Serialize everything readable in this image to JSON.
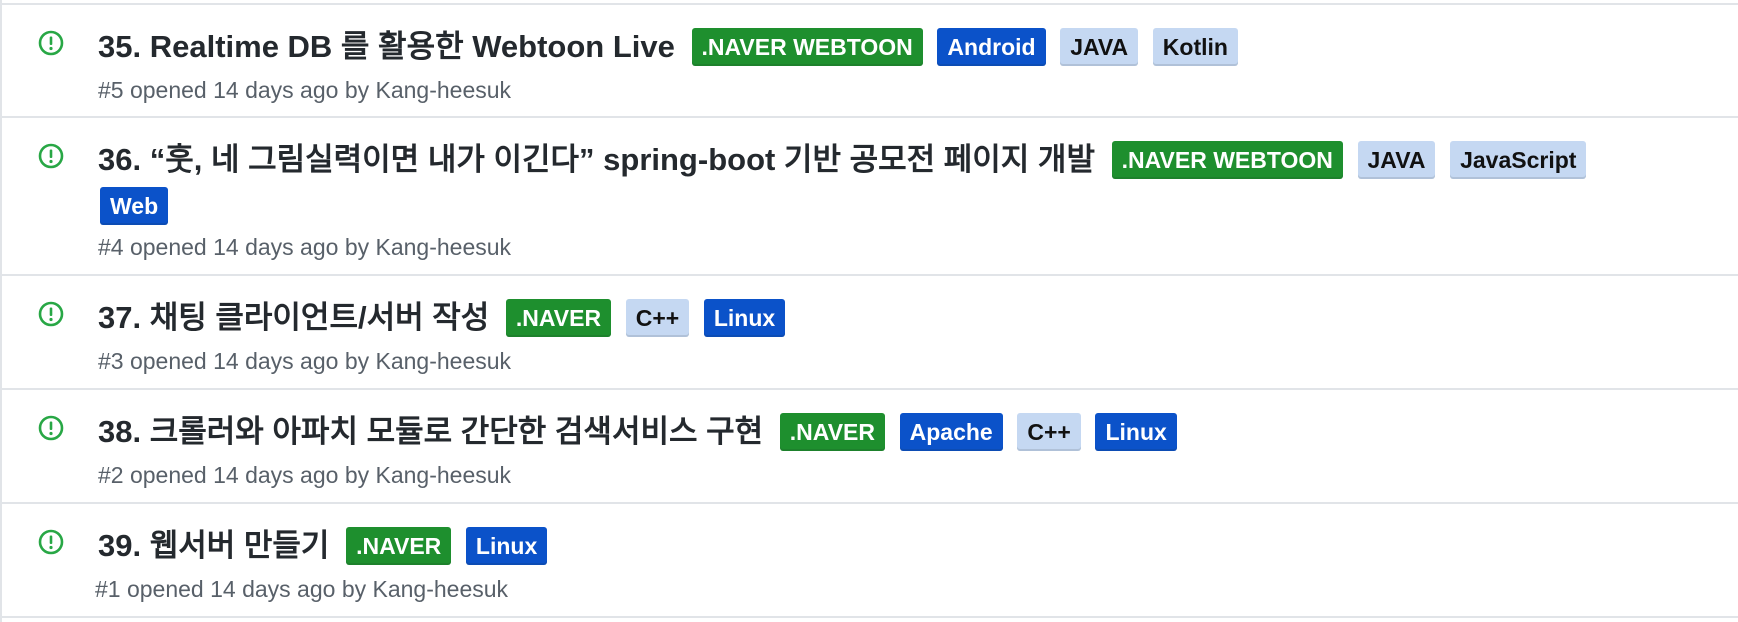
{
  "colors": {
    "open_icon": "#28a745",
    "border": "#e1e4e8",
    "meta_text": "#586069"
  },
  "label_styles": {
    ".NAVER WEBTOON": {
      "bg": "#1e8f2e",
      "fg": "#ffffff"
    },
    ".NAVER": {
      "bg": "#1e8f2e",
      "fg": "#ffffff"
    },
    "Android": {
      "bg": "#0b52c9",
      "fg": "#ffffff"
    },
    "Web": {
      "bg": "#0b52c9",
      "fg": "#ffffff"
    },
    "Linux": {
      "bg": "#0b52c9",
      "fg": "#ffffff"
    },
    "Apache": {
      "bg": "#0b52c9",
      "fg": "#ffffff"
    },
    "JAVA": {
      "bg": "#c5d8f2",
      "fg": "#111111"
    },
    "Kotlin": {
      "bg": "#c5d8f2",
      "fg": "#111111"
    },
    "JavaScript": {
      "bg": "#c5d8f2",
      "fg": "#111111"
    },
    "C++": {
      "bg": "#c5d8f2",
      "fg": "#111111"
    }
  },
  "issues": [
    {
      "icon": "issue-opened-icon",
      "title": "35. Realtime DB 를 활용한 Webtoon Live",
      "labels": [
        ".NAVER WEBTOON",
        "Android",
        "JAVA",
        "Kotlin"
      ],
      "meta": "#5 opened 14 days ago by Kang-heesuk"
    },
    {
      "icon": "issue-opened-icon",
      "title": "36. “훗, 네 그림실력이면 내가 이긴다” spring-boot 기반 공모전 페이지 개발",
      "labels": [
        ".NAVER WEBTOON",
        "JAVA",
        "JavaScript",
        "Web"
      ],
      "meta": "#4 opened 14 days ago by Kang-heesuk"
    },
    {
      "icon": "issue-opened-icon",
      "title": "37. 채팅 클라이언트/서버 작성",
      "labels": [
        ".NAVER",
        "C++",
        "Linux"
      ],
      "meta": "#3 opened 14 days ago by Kang-heesuk"
    },
    {
      "icon": "issue-opened-icon",
      "title": "38. 크롤러와 아파치 모듈로 간단한 검색서비스 구현",
      "labels": [
        ".NAVER",
        "Apache",
        "C++",
        "Linux"
      ],
      "meta": "#2 opened 14 days ago by Kang-heesuk"
    },
    {
      "icon": "issue-opened-icon",
      "title": "39. 웹서버 만들기",
      "labels": [
        ".NAVER",
        "Linux"
      ],
      "meta": "#1 opened 14 days ago by Kang-heesuk"
    }
  ]
}
